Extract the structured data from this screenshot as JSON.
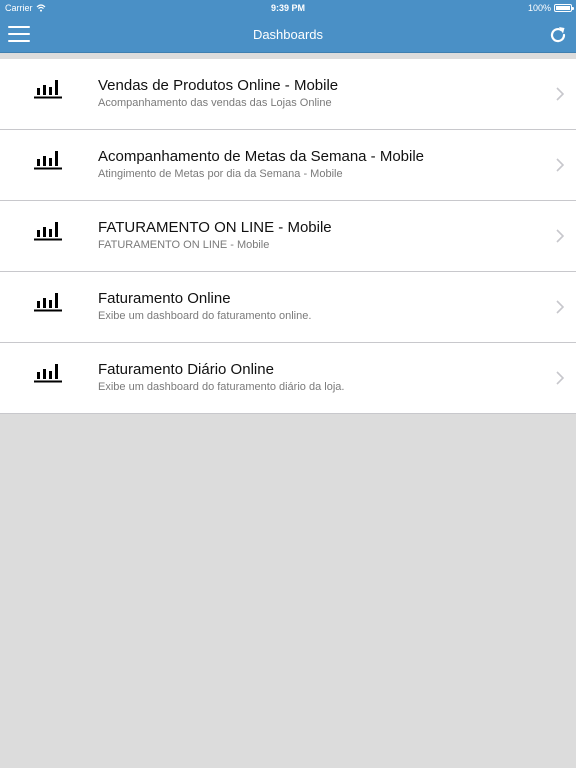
{
  "status_bar": {
    "carrier": "Carrier",
    "time": "9:39 PM",
    "battery": "100%"
  },
  "nav_bar": {
    "title": "Dashboards",
    "menu_icon": "hamburger-menu-icon",
    "refresh_icon": "refresh-icon"
  },
  "dashboards": [
    {
      "title": "Vendas de Produtos Online - Mobile",
      "subtitle": "Acompanhamento das vendas das Lojas Online"
    },
    {
      "title": "Acompanhamento de Metas da Semana - Mobile",
      "subtitle": "Atingimento de Metas por dia da Semana - Mobile"
    },
    {
      "title": "FATURAMENTO ON LINE - Mobile",
      "subtitle": "FATURAMENTO ON LINE - Mobile"
    },
    {
      "title": "Faturamento Online",
      "subtitle": "Exibe um dashboard do faturamento online."
    },
    {
      "title": "Faturamento Diário Online",
      "subtitle": "Exibe um dashboard do faturamento diário da loja."
    }
  ],
  "colors": {
    "accent": "#4a90c6",
    "background": "#dcdcdc",
    "list_background": "#ffffff",
    "subtitle_text": "#7a7a7a"
  }
}
